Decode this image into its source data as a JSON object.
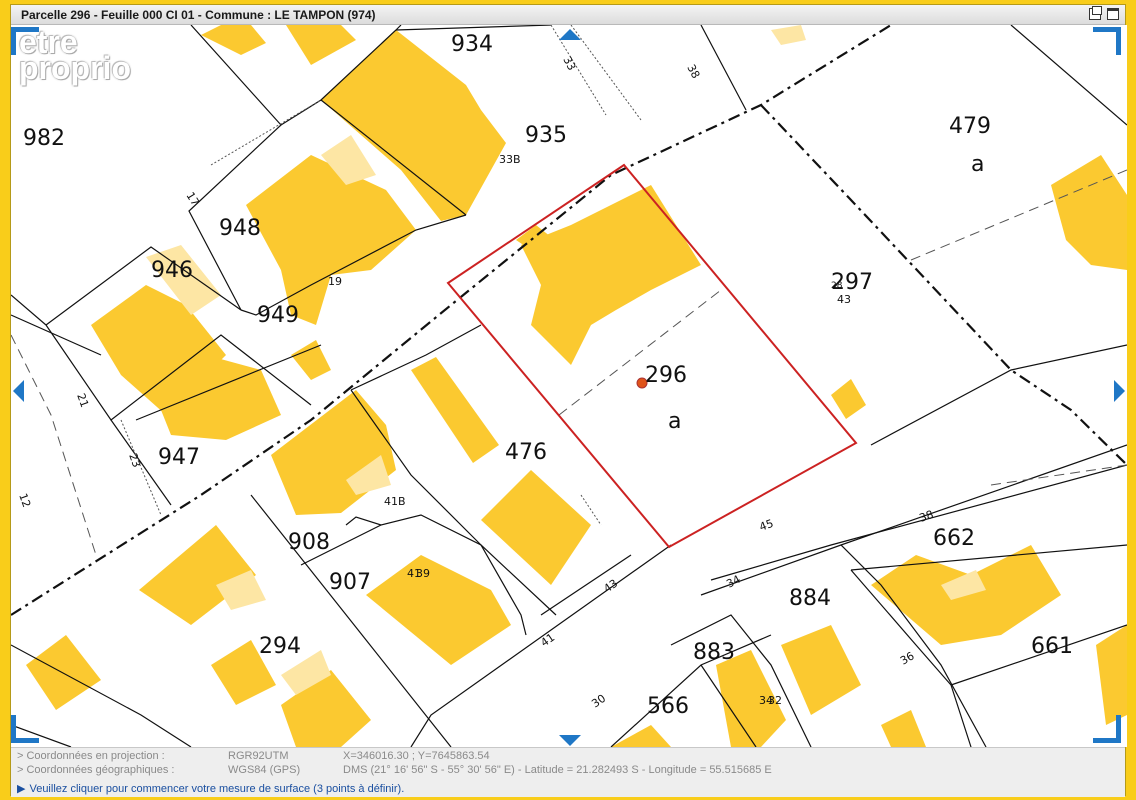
{
  "window": {
    "title": "Parcelle 296 - Feuille 000 CI 01 - Commune : LE TAMPON (974)"
  },
  "logo": {
    "line1": "etre",
    "line2": "proprio"
  },
  "map": {
    "parcel_numbers": {
      "p934": "934",
      "p935": "935",
      "p982": "982",
      "p948": "948",
      "p946": "946",
      "p949": "949",
      "p947": "947",
      "p476": "476",
      "p296": "296",
      "p297": "297",
      "p479": "479",
      "p908": "908",
      "p907": "907",
      "p294": "294",
      "p662": "662",
      "p884": "884",
      "p883": "883",
      "p566": "566",
      "p661": "661"
    },
    "subdivision_letters": {
      "a296": "a",
      "a479": "a"
    },
    "street_numbers": {
      "n33B": "33B",
      "n19": "19",
      "n41B": "41B",
      "n41": "41",
      "n39": "39",
      "n43p297": "43",
      "n28": "28",
      "n34bldg": "34",
      "n32": "32"
    },
    "road_numbers": {
      "r33": "33",
      "r38top": "38",
      "r17": "17",
      "r21": "21",
      "r23": "23",
      "r12": "12",
      "r45": "45",
      "r38": "38",
      "r43": "43",
      "r41": "41",
      "r34": "34",
      "r30": "30",
      "r36": "36"
    },
    "colors": {
      "building": "#fbc930",
      "building_light": "#fde6a4",
      "parcel_line": "#111111",
      "selected_parcel": "#cc2222",
      "marker": "#e0541a",
      "nav_accent": "#1f77c6"
    },
    "icons": {
      "pan": "triangle-arrow-icon",
      "marker": "location-dot-icon"
    }
  },
  "info_panel": {
    "projection": {
      "label": "> Coordonnées en projection :",
      "system": "RGR92UTM",
      "value": "X=346016.30 ; Y=7645863.54"
    },
    "geographic": {
      "label": "> Coordonnées géographiques :",
      "system": "WGS84 (GPS)",
      "value": "DMS (21° 16' 56\" S - 55° 30' 56\" E) - Latitude = 21.282493 S - Longitude = 55.515685 E"
    },
    "status": "Veuillez cliquer pour commencer votre mesure de surface (3 points à définir)."
  }
}
